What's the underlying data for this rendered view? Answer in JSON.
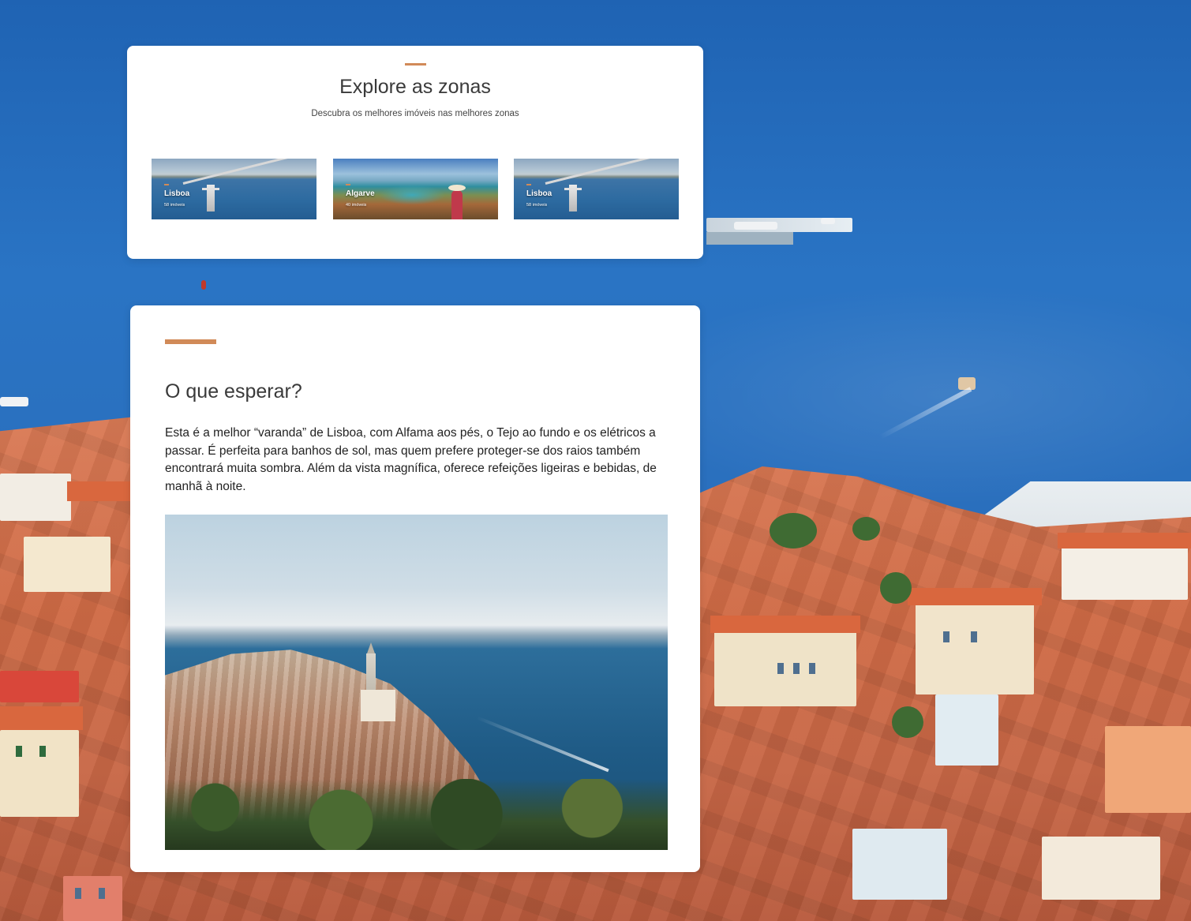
{
  "zones_section": {
    "title": "Explore as zonas",
    "subtitle": "Descubra os melhores imóveis nas melhores zonas",
    "zones": [
      {
        "name": "Lisboa",
        "count": "58 imóveis"
      },
      {
        "name": "Algarve",
        "count": "40 imóveis"
      },
      {
        "name": "Lisboa",
        "count": "58 imóveis"
      }
    ]
  },
  "expect_section": {
    "title": "O que esperar?",
    "body": "Esta é a melhor “varanda” de Lisboa, com Alfama aos pés, o Tejo ao fundo e os elétricos a passar. É perfeita para banhos de sol, mas quem prefere proteger-se dos raios também encontrará muita sombra. Além da vista magnífica, oferece refeições ligeiras e bebidas, de manhã à noite."
  },
  "colors": {
    "accent": "#d18a58",
    "card_background": "#ffffff",
    "title_text": "#3a3a3a"
  }
}
